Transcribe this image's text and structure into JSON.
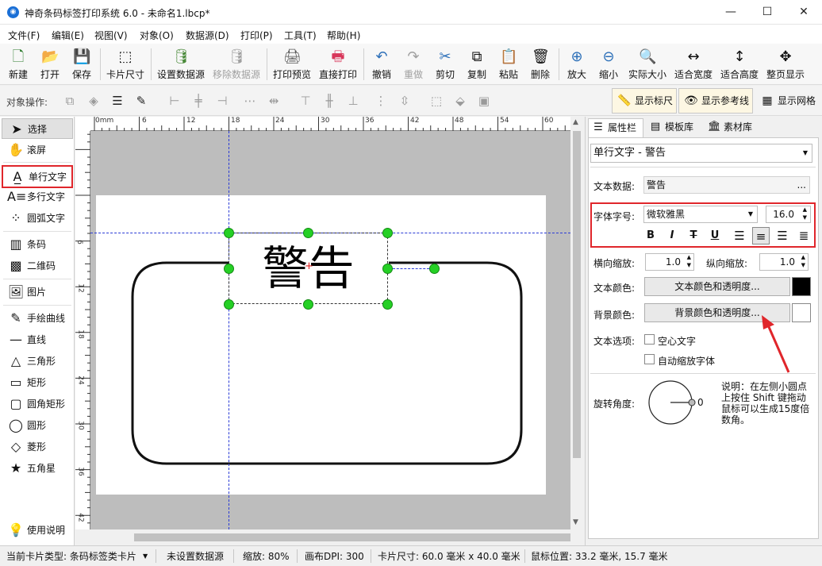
{
  "window": {
    "title": "神奇条码标签打印系统 6.0 - 未命名1.lbcp*",
    "min": "—",
    "max": "☐",
    "close": "✕"
  },
  "menu": [
    "文件(F)",
    "编辑(E)",
    "视图(V)",
    "对象(O)",
    "数据源(D)",
    "打印(P)",
    "工具(T)",
    "帮助(H)"
  ],
  "toolbar": [
    {
      "label": "新建",
      "icon": "new-file-icon",
      "glyph": "🗋",
      "enabled": true
    },
    {
      "label": "打开",
      "icon": "open-icon",
      "glyph": "📂",
      "enabled": true
    },
    {
      "label": "保存",
      "icon": "save-icon",
      "glyph": "💾",
      "enabled": true
    },
    {
      "label": "卡片尺寸",
      "icon": "card-size-icon",
      "glyph": "⬚",
      "enabled": true
    },
    {
      "label": "设置数据源",
      "icon": "database-icon",
      "glyph": "🛢",
      "enabled": true
    },
    {
      "label": "移除数据源",
      "icon": "remove-database-icon",
      "glyph": "🛢",
      "enabled": false
    },
    {
      "label": "打印预览",
      "icon": "print-preview-icon",
      "glyph": "🖨",
      "enabled": true
    },
    {
      "label": "直接打印",
      "icon": "print-icon",
      "glyph": "🖶",
      "enabled": true
    },
    {
      "label": "撤销",
      "icon": "undo-icon",
      "glyph": "↶",
      "enabled": true
    },
    {
      "label": "重做",
      "icon": "redo-icon",
      "glyph": "↷",
      "enabled": false
    },
    {
      "label": "剪切",
      "icon": "cut-icon",
      "glyph": "✂",
      "enabled": true
    },
    {
      "label": "复制",
      "icon": "copy-icon",
      "glyph": "⧉",
      "enabled": true
    },
    {
      "label": "粘贴",
      "icon": "paste-icon",
      "glyph": "📋",
      "enabled": true
    },
    {
      "label": "删除",
      "icon": "delete-icon",
      "glyph": "🗑",
      "enabled": true
    },
    {
      "label": "放大",
      "icon": "zoom-in-icon",
      "glyph": "⊕",
      "enabled": true
    },
    {
      "label": "缩小",
      "icon": "zoom-out-icon",
      "glyph": "⊖",
      "enabled": true
    },
    {
      "label": "实际大小",
      "icon": "actual-size-icon",
      "glyph": "🔍",
      "enabled": true
    },
    {
      "label": "适合宽度",
      "icon": "fit-width-icon",
      "glyph": "↔",
      "enabled": true
    },
    {
      "label": "适合高度",
      "icon": "fit-height-icon",
      "glyph": "↕",
      "enabled": true
    },
    {
      "label": "整页显示",
      "icon": "fit-page-icon",
      "glyph": "✥",
      "enabled": true
    }
  ],
  "ops": {
    "label": "对象操作:",
    "toggles": [
      {
        "label": "显示标尺",
        "icon": "ruler-icon",
        "glyph": "📏",
        "active": true
      },
      {
        "label": "显示参考线",
        "icon": "guideline-icon",
        "glyph": "👁",
        "active": true
      },
      {
        "label": "显示网格",
        "icon": "grid-icon",
        "glyph": "▦",
        "active": false
      }
    ]
  },
  "tools": [
    {
      "label": "选择",
      "icon": "pointer-icon",
      "glyph": "➤"
    },
    {
      "label": "滚屏",
      "icon": "hand-icon",
      "glyph": "✋"
    },
    {
      "label": "单行文字",
      "icon": "single-line-text-icon",
      "glyph": "A̲"
    },
    {
      "label": "多行文字",
      "icon": "multi-line-text-icon",
      "glyph": "A≡"
    },
    {
      "label": "圆弧文字",
      "icon": "arc-text-icon",
      "glyph": "⁘"
    },
    {
      "label": "条码",
      "icon": "barcode-icon",
      "glyph": "▥"
    },
    {
      "label": "二维码",
      "icon": "qrcode-icon",
      "glyph": "▩"
    },
    {
      "label": "图片",
      "icon": "picture-icon",
      "glyph": "🖼"
    },
    {
      "label": "手绘曲线",
      "icon": "freehand-icon",
      "glyph": "✎"
    },
    {
      "label": "直线",
      "icon": "line-icon",
      "glyph": "—"
    },
    {
      "label": "三角形",
      "icon": "triangle-icon",
      "glyph": "△"
    },
    {
      "label": "矩形",
      "icon": "rectangle-icon",
      "glyph": "▭"
    },
    {
      "label": "圆角矩形",
      "icon": "rounded-rect-icon",
      "glyph": "▢"
    },
    {
      "label": "圆形",
      "icon": "circle-icon",
      "glyph": "◯"
    },
    {
      "label": "菱形",
      "icon": "diamond-icon",
      "glyph": "◇"
    },
    {
      "label": "五角星",
      "icon": "star-icon",
      "glyph": "★"
    }
  ],
  "help_label": "使用说明",
  "ruler": {
    "top": [
      "0mm",
      "6",
      "12",
      "18",
      "24",
      "30",
      "36",
      "42",
      "48",
      "54",
      "60"
    ],
    "left": [
      "6",
      "12",
      "18",
      "24",
      "30",
      "36",
      "42"
    ]
  },
  "canvas": {
    "text": "警告"
  },
  "right": {
    "tabs": [
      "属性栏",
      "模板库",
      "素材库"
    ],
    "object_select": "单行文字 - 警告",
    "text_data_label": "文本数据:",
    "text_data_value": "警告",
    "text_data_more": "...",
    "font_label": "字体字号:",
    "font_name": "微软雅黑",
    "font_size": "16.0",
    "format": [
      "B",
      "I",
      "T",
      "U"
    ],
    "hscale_label": "横向缩放:",
    "hscale": "1.0",
    "vscale_label": "纵向缩放:",
    "vscale": "1.0",
    "text_color_label": "文本颜色:",
    "text_color_button": "文本颜色和透明度...",
    "text_color": "#000000",
    "bg_color_label": "背景颜色:",
    "bg_color_button": "背景颜色和透明度...",
    "bg_color": "#ffffff",
    "text_options_label": "文本选项:",
    "hollow_label": "空心文字",
    "autofit_label": "自动缩放字体",
    "rotation_label": "旋转角度:",
    "rotation_value": "0",
    "rotation_help": "说明：在左侧小圆点上按住 Shift 键拖动鼠标可以生成15度倍数角。"
  },
  "status": {
    "card_type": "当前卡片类型: 条码标签类卡片",
    "datasource": "未设置数据源",
    "zoom": "缩放: 80%",
    "dpi": "画布DPI: 300",
    "card_size": "卡片尺寸: 60.0 毫米 x 40.0 毫米",
    "mouse_pos": "鼠标位置: 33.2 毫米, 15.7 毫米"
  }
}
